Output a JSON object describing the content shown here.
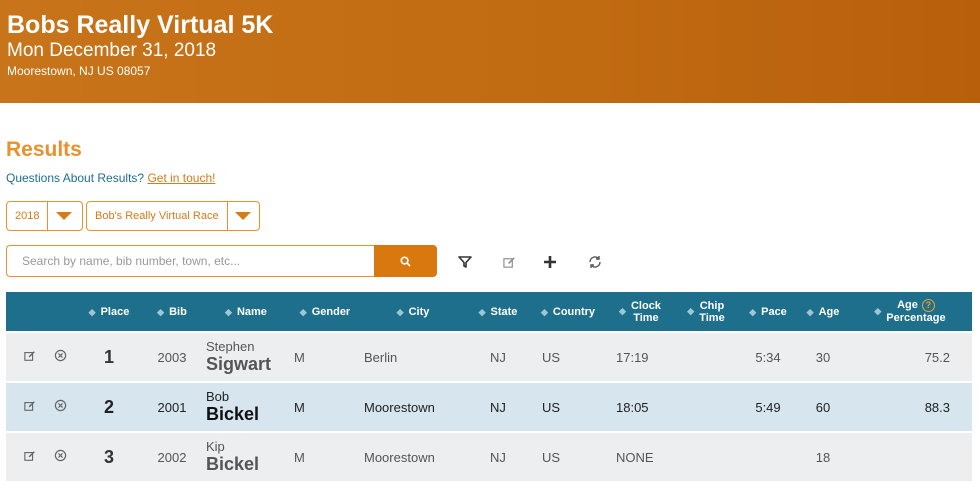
{
  "event": {
    "title": "Bobs Really Virtual 5K",
    "date": "Mon December 31, 2018",
    "location": "Moorestown, NJ US 08057"
  },
  "results": {
    "heading": "Results",
    "questions_text": "Questions About Results?",
    "contact_link": "Get in touch!",
    "year_select": "2018",
    "race_select": "Bob's Really Virtual Race",
    "search_placeholder": "Search by name, bib number, town, etc...",
    "columns": {
      "place": "Place",
      "bib": "Bib",
      "name": "Name",
      "gender": "Gender",
      "city": "City",
      "state": "State",
      "country": "Country",
      "clock_time_1": "Clock",
      "clock_time_2": "Time",
      "chip_time_1": "Chip",
      "chip_time_2": "Time",
      "pace": "Pace",
      "age": "Age",
      "age_pct_1": "Age",
      "age_pct_2": "Percentage",
      "help": "?"
    },
    "rows": [
      {
        "place": "1",
        "bib": "2003",
        "first": "Stephen",
        "last": "Sigwart",
        "gender": "M",
        "city": "Berlin",
        "state": "NJ",
        "country": "US",
        "clock": "17:19",
        "chip": "",
        "pace": "5:34",
        "age": "30",
        "age_pct": "75.2"
      },
      {
        "place": "2",
        "bib": "2001",
        "first": "Bob",
        "last": "Bickel",
        "gender": "M",
        "city": "Moorestown",
        "state": "NJ",
        "country": "US",
        "clock": "18:05",
        "chip": "",
        "pace": "5:49",
        "age": "60",
        "age_pct": "88.3"
      },
      {
        "place": "3",
        "bib": "2002",
        "first": "Kip",
        "last": "Bickel",
        "gender": "M",
        "city": "Moorestown",
        "state": "NJ",
        "country": "US",
        "clock": "NONE",
        "chip": "",
        "pace": "",
        "age": "18",
        "age_pct": ""
      }
    ]
  },
  "icons": [
    "search-icon",
    "filter-icon",
    "edit-icon",
    "plus-icon",
    "refresh-icon",
    "remove-icon",
    "sort-icon",
    "help-icon"
  ],
  "colors": {
    "brand": "#c8741a",
    "accent": "#e8912d",
    "header_bg": "#1e6f8c",
    "row_highlight": "#d6e5ee"
  }
}
